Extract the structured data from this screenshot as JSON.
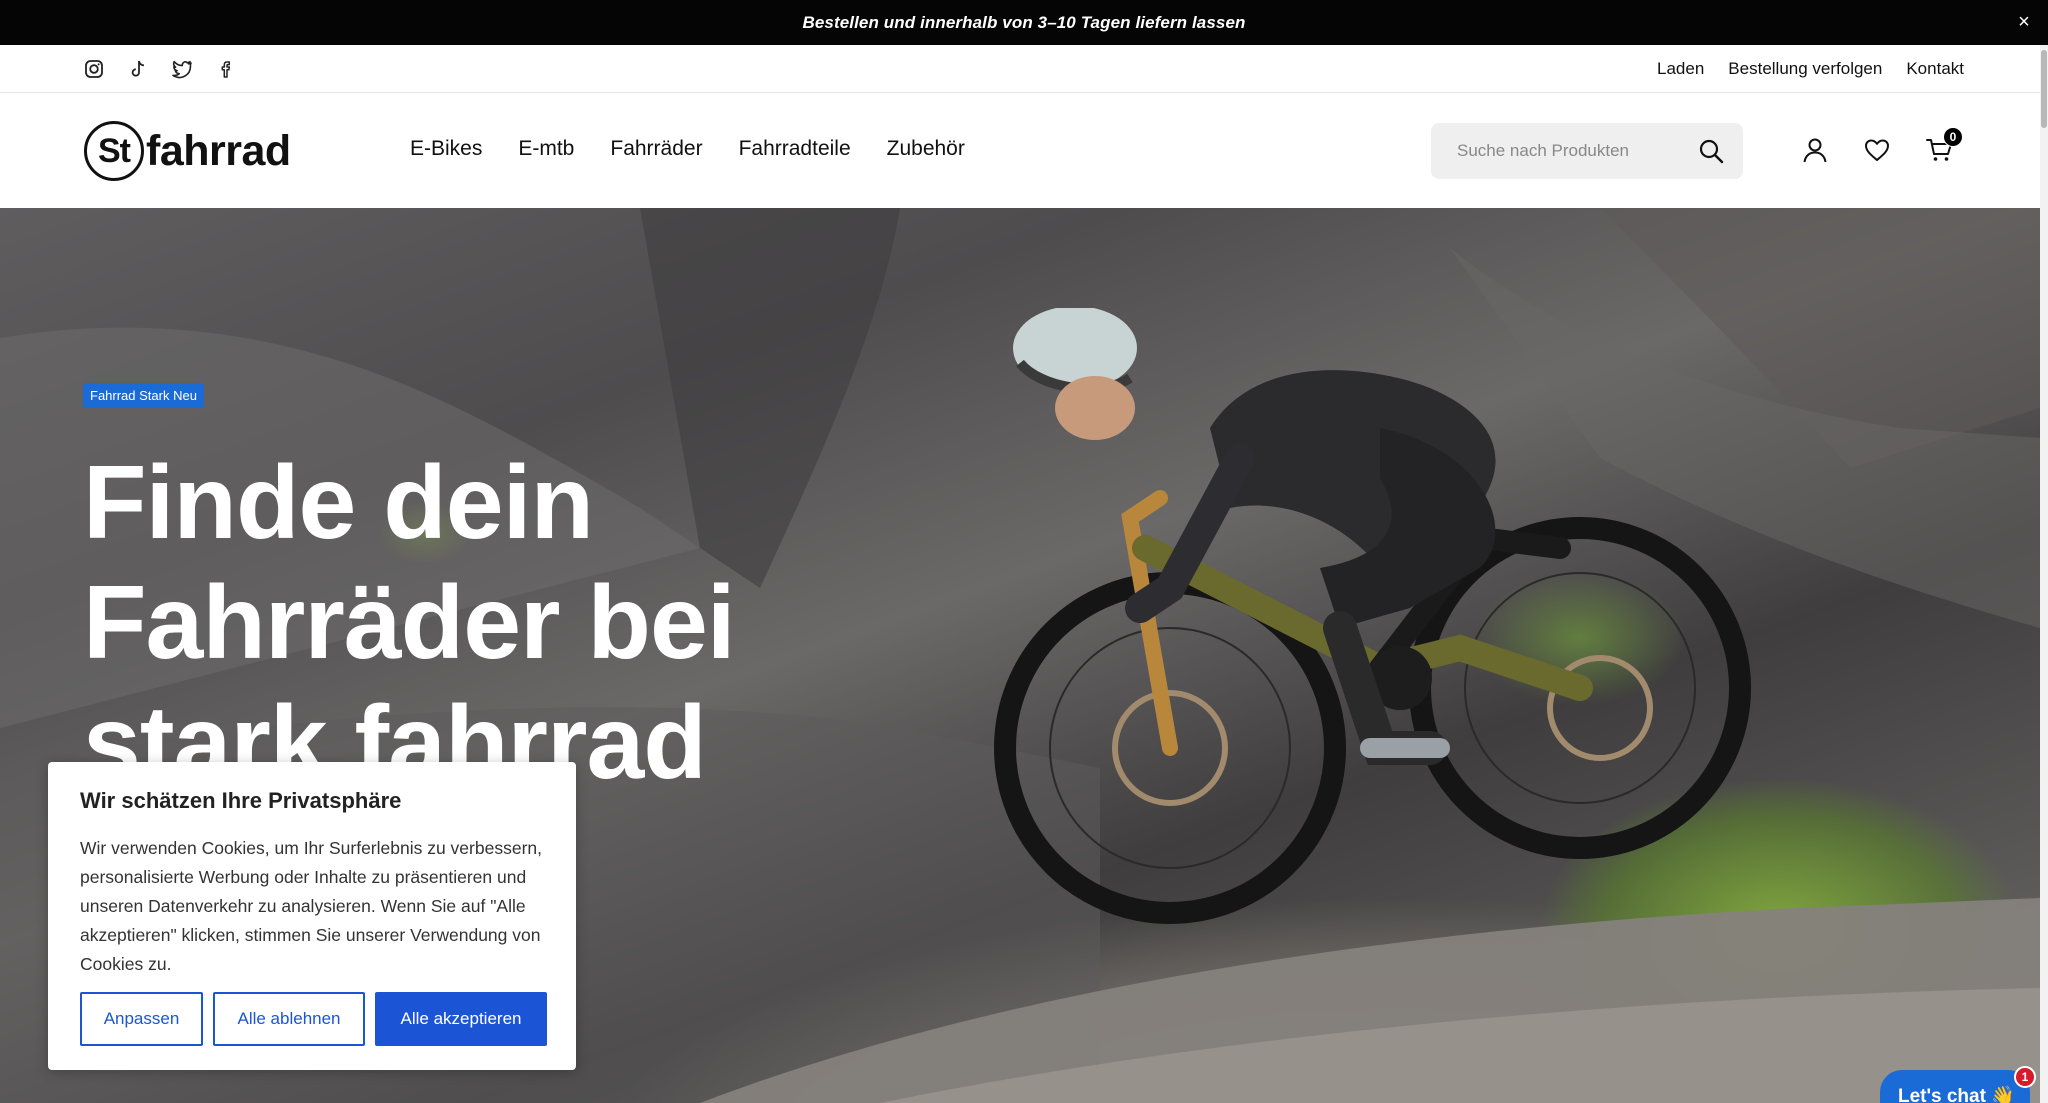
{
  "announcement": {
    "text": "Bestellen und innerhalb von 3–10 Tagen liefern lassen",
    "close": "×"
  },
  "socials": [
    "instagram-icon",
    "tiktok-icon",
    "twitter-icon",
    "facebook-icon"
  ],
  "utility_links": [
    "Laden",
    "Bestellung verfolgen",
    "Kontakt"
  ],
  "logo": {
    "mark": "St",
    "word": "fahrrad"
  },
  "nav": [
    "E-Bikes",
    "E-mtb",
    "Fahrräder",
    "Fahrradteile",
    "Zubehör"
  ],
  "search": {
    "placeholder": "Suche nach Produkten"
  },
  "cart": {
    "count": "0"
  },
  "hero": {
    "badge": "Fahrrad Stark Neu",
    "title_line1": "Finde dein",
    "title_line2": "Fahrräder bei",
    "title_line3": "stark fahrrad"
  },
  "cookie": {
    "title": "Wir schätzen Ihre Privatsphäre",
    "text": "Wir verwenden Cookies, um Ihr Surferlebnis zu verbessern, personalisierte Werbung oder Inhalte zu präsentieren und unseren Datenverkehr zu analysieren. Wenn Sie auf \"Alle akzeptieren\" klicken, stimmen Sie unserer Verwendung von Cookies zu.",
    "btn_customize": "Anpassen",
    "btn_reject": "Alle ablehnen",
    "btn_accept": "Alle akzeptieren"
  },
  "chat": {
    "label": "Let's chat 👋",
    "badge": "1"
  },
  "colors": {
    "accent": "#1b55d6",
    "badge_blue": "#1b6bd6",
    "announce_bg": "#050505"
  }
}
